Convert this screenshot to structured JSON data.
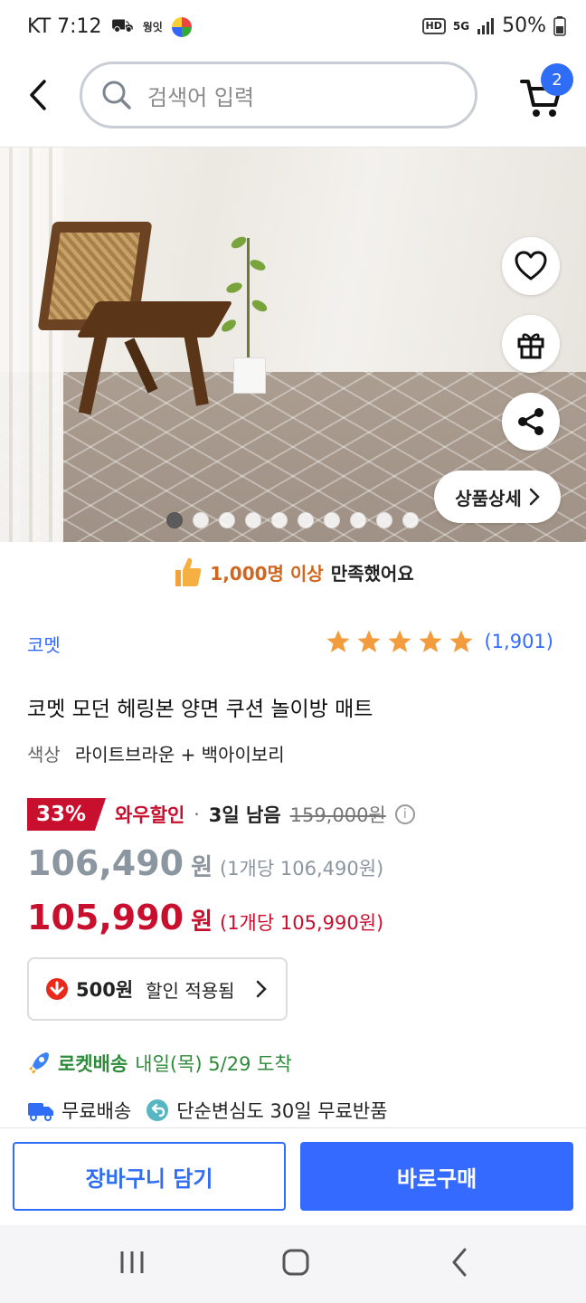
{
  "status_bar": {
    "carrier_time": "KT 7:12",
    "app_label": "웡잇",
    "battery": "50%",
    "hd": "HD",
    "network": "5G"
  },
  "header": {
    "search_placeholder": "검색어 입력",
    "cart_count": "2"
  },
  "hero": {
    "detail_button": "상품상세",
    "image_count": 10,
    "active_index": 0
  },
  "satisfaction": {
    "highlight": "1,000명 이상",
    "rest": "만족했어요"
  },
  "product": {
    "brand": "코멧",
    "rating_stars": 5,
    "review_count": "(1,901)",
    "title": "코멧 모던 헤링본 양면 쿠션 놀이방 매트",
    "option_label": "색상",
    "option_value": "라이트브라운 + 백아이보리"
  },
  "pricing": {
    "discount_pct": "33%",
    "wow_label": "와우할인",
    "separator": "·",
    "days_left": "3일 남음",
    "original_price": "159,000원",
    "price_regular": "106,490",
    "price_regular_won": "원",
    "price_regular_unit": "(1개당 106,490원)",
    "price_sale": "105,990",
    "price_sale_won": "원",
    "price_sale_unit": "(1개당 105,990원)"
  },
  "coupon": {
    "amount": "500원",
    "text": "할인 적용됨"
  },
  "delivery": {
    "rocket_label": "로켓배송",
    "arrival": "내일(목) 5/29 도착",
    "free_shipping": "무료배송",
    "free_return": "단순변심도 30일 무료반품"
  },
  "actions": {
    "add_to_cart": "장바구니 담기",
    "buy_now": "바로구매"
  },
  "colors": {
    "accent_blue": "#346aff",
    "sale_red": "#c8102e",
    "rocket_green": "#2e8b3a",
    "star_orange": "#f39c3d"
  }
}
